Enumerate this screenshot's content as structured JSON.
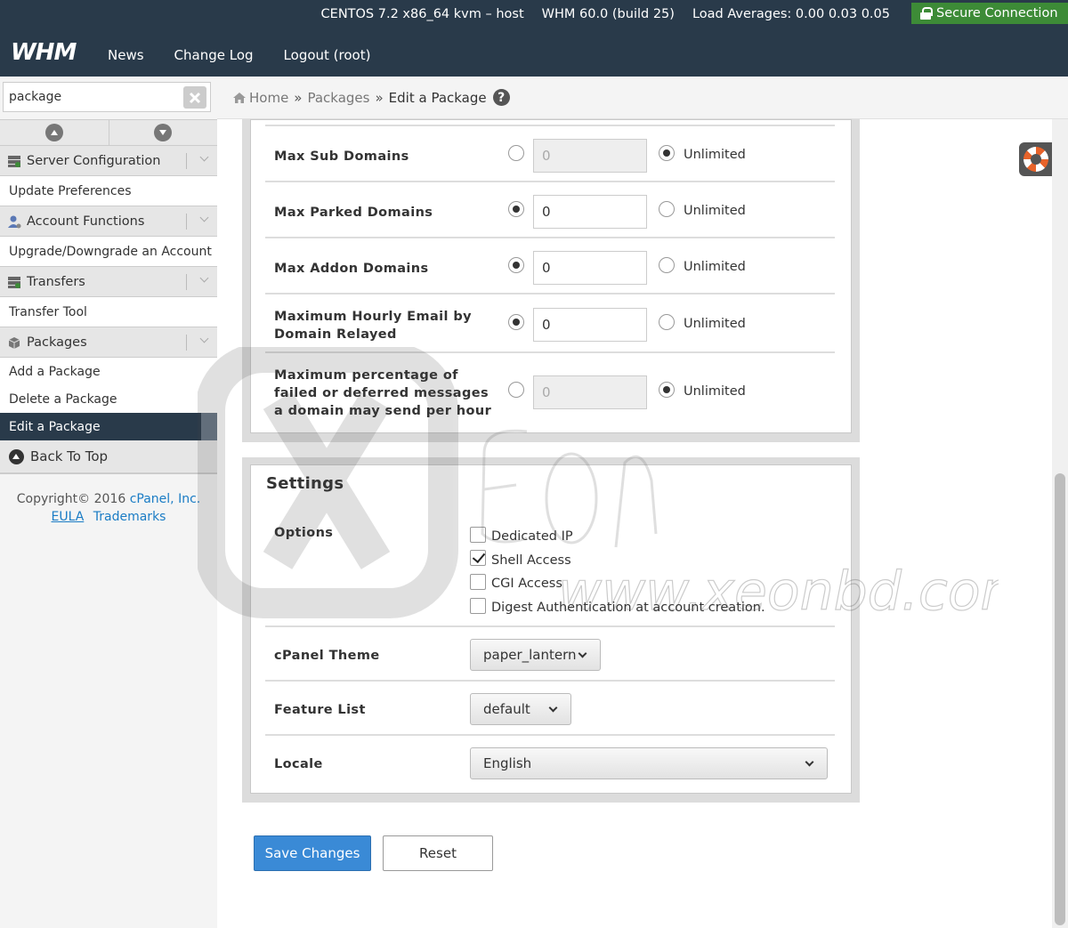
{
  "topbar": {
    "system_info": "CENTOS 7.2 x86_64 kvm – host",
    "version": "WHM 60.0 (build 25)",
    "load": "Load Averages: 0.00 0.03 0.05",
    "secure": "Secure Connection",
    "logo": "WHM",
    "nav": [
      "News",
      "Change Log",
      "Logout (root)"
    ]
  },
  "sidebar": {
    "search_value": "package",
    "categories": {
      "server_config": "Server Configuration",
      "account_functions": "Account Functions",
      "transfers": "Transfers",
      "packages": "Packages"
    },
    "items": {
      "update_prefs": "Update Preferences",
      "upgrade_downgrade": "Upgrade/Downgrade an Account",
      "transfer_tool": "Transfer Tool",
      "add_package": "Add a Package",
      "delete_package": "Delete a Package",
      "edit_package": "Edit a Package"
    },
    "back_to_top": "Back To Top",
    "copyright": "Copyright© 2016",
    "cpanel": "cPanel, Inc.",
    "eula": "EULA",
    "trademarks": "Trademarks"
  },
  "breadcrumb": {
    "home": "Home",
    "packages": "Packages",
    "current": "Edit a Package",
    "sep": "»",
    "help": "?"
  },
  "limits": [
    {
      "label": "Max Sub Domains",
      "value": "0",
      "unlimited": true,
      "unlimited_label": "Unlimited"
    },
    {
      "label": "Max Parked Domains",
      "value": "0",
      "unlimited": false,
      "unlimited_label": "Unlimited"
    },
    {
      "label": "Max Addon Domains",
      "value": "0",
      "unlimited": false,
      "unlimited_label": "Unlimited"
    },
    {
      "label_line1": "Maximum Hourly Email by",
      "label_line2": "Domain Relayed",
      "value": "0",
      "unlimited": false,
      "unlimited_label": "Unlimited"
    },
    {
      "label_line1": "Maximum percentage of",
      "label_line2": "failed or deferred messages",
      "label_line3": "a domain may send per hour",
      "value": "0",
      "unlimited": true,
      "unlimited_label": "Unlimited"
    }
  ],
  "settings": {
    "title": "Settings",
    "options_label": "Options",
    "options": [
      {
        "label": "Dedicated IP",
        "checked": false
      },
      {
        "label": "Shell Access",
        "checked": true
      },
      {
        "label": "CGI Access",
        "checked": false
      },
      {
        "label": "Digest Authentication at account creation.",
        "checked": false
      }
    ],
    "theme_label": "cPanel Theme",
    "theme_value": "paper_lantern",
    "feature_label": "Feature List",
    "feature_value": "default",
    "locale_label": "Locale",
    "locale_value": "English"
  },
  "actions": {
    "save": "Save Changes",
    "reset": "Reset"
  },
  "watermark": {
    "text": "www.xeonbd.com",
    "brand": "EON"
  },
  "colors": {
    "topbar": "#293a4a",
    "secure": "#3d8b37",
    "primary": "#3a8ad6",
    "link": "#1a7cc5"
  }
}
